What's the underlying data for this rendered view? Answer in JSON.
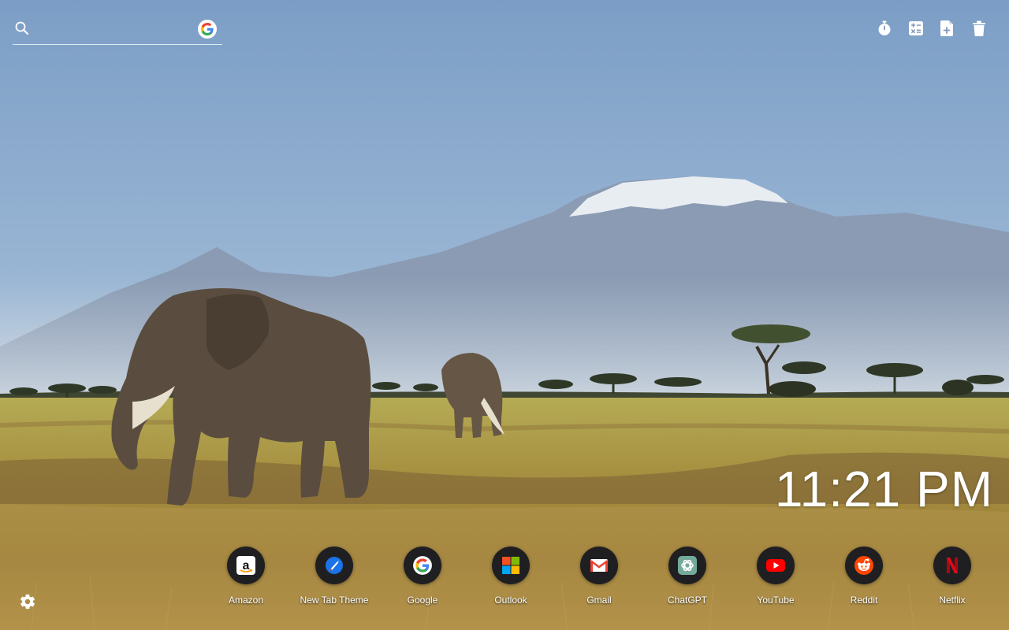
{
  "search": {
    "placeholder": "",
    "value": "",
    "engine_icon": "google-icon"
  },
  "toolbar": {
    "icons": [
      "stopwatch-icon",
      "calculator-icon",
      "add-document-icon",
      "trash-icon"
    ]
  },
  "clock": {
    "time": "11:21 PM"
  },
  "dock": {
    "apps": [
      {
        "label": "Amazon",
        "icon": "amazon-icon",
        "color": "#ffffff"
      },
      {
        "label": "New Tab Theme",
        "icon": "new-tab-theme-icon",
        "color": "#1a73e8"
      },
      {
        "label": "Google",
        "icon": "google-icon",
        "color": "#4285f4"
      },
      {
        "label": "Outlook",
        "icon": "microsoft-icon",
        "color": "#f25022"
      },
      {
        "label": "Gmail",
        "icon": "gmail-icon",
        "color": "#ea4335"
      },
      {
        "label": "ChatGPT",
        "icon": "chatgpt-icon",
        "color": "#74aa9c"
      },
      {
        "label": "YouTube",
        "icon": "youtube-icon",
        "color": "#ff0000"
      },
      {
        "label": "Reddit",
        "icon": "reddit-icon",
        "color": "#ff4500"
      },
      {
        "label": "Netflix",
        "icon": "netflix-icon",
        "color": "#e50914"
      }
    ]
  },
  "settings": {
    "icon": "gear-icon"
  }
}
